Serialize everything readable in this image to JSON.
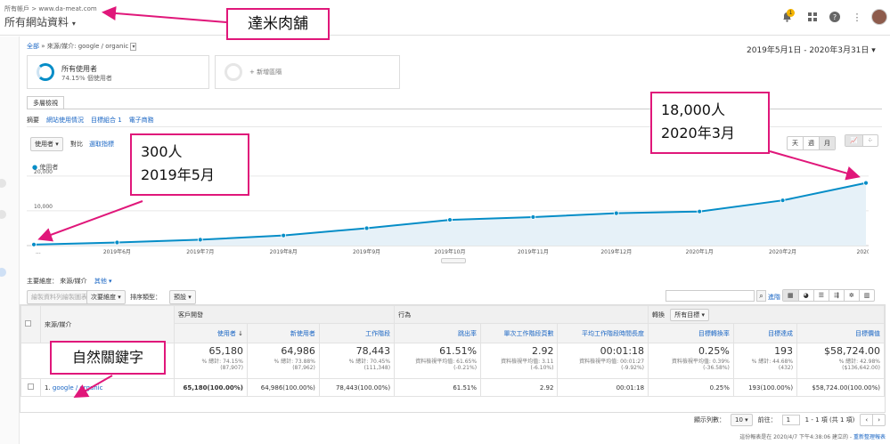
{
  "header": {
    "account_line": "所有帳戶 > www.da-meat.com",
    "property": "所有網站資料",
    "bell_badge": "1"
  },
  "breadcrumb": {
    "all": "全部",
    "sep": "»",
    "path": "來源/媒介: google / organic"
  },
  "date_range": "2019年5月1日 - 2020年3月31日",
  "segments": {
    "seg1_title": "所有使用者",
    "seg1_sub": "74.15% 個使用者",
    "add_label": "+ 新增區隔"
  },
  "tabs": {
    "main_tab": "多層檢視",
    "subtabs": [
      "摘要",
      "網站使用情況",
      "目標組合 1",
      "電子商務"
    ]
  },
  "chart_controls": {
    "metric_select": "使用者",
    "vs_label": "對比",
    "pick_metric": "選取指標",
    "legend": "使用者",
    "periods": [
      "天",
      "週",
      "月"
    ]
  },
  "chart_data": {
    "type": "area",
    "x": [
      "2019-05",
      "2019-06",
      "2019-07",
      "2019-08",
      "2019-09",
      "2019-10",
      "2019-11",
      "2019-12",
      "2020-01",
      "2020-02",
      "2020-03"
    ],
    "x_tick_labels": [
      "...",
      "2019年6月",
      "2019年7月",
      "2019年8月",
      "2019年9月",
      "2019年10月",
      "2019年11月",
      "2019年12月",
      "2020年1月",
      "2020年2月",
      "2020..."
    ],
    "series": [
      {
        "name": "使用者",
        "values": [
          300,
          900,
          1700,
          2900,
          5000,
          7400,
          8200,
          9300,
          9800,
          13000,
          18000
        ]
      }
    ],
    "y_ticks": [
      "20,000",
      "10,000"
    ],
    "ylim": [
      0,
      22000
    ],
    "color": "#058dc7",
    "grid": true
  },
  "toolbar": {
    "primary_dim_label": "主要維度：",
    "primary_dim": "來源/媒介",
    "other": "其他",
    "plot_rows": "繪製資料列繪製圖表",
    "secondary_dim": "次要維度",
    "sort_label": "排序類型：",
    "sort_value": "預設",
    "advanced": "進階"
  },
  "table": {
    "dim_header": "來源/媒介",
    "group_acq": "客戶開發",
    "group_beh": "行為",
    "group_conv": "轉換",
    "goal_select": "所有目標",
    "columns": [
      "使用者",
      "新使用者",
      "工作階段",
      "跳出率",
      "單次工作階段頁數",
      "平均工作階段時間長度",
      "目標轉換率",
      "目標達成",
      "目標價值"
    ],
    "totals": [
      {
        "big": "65,180",
        "sm": "% 總計: 74.15% (87,907)"
      },
      {
        "big": "64,986",
        "sm": "% 總計: 73.88% (87,962)"
      },
      {
        "big": "78,443",
        "sm": "% 總計: 70.45% (111,348)"
      },
      {
        "big": "61.51%",
        "sm": "資料檢視平均值: 61.65% (-0.21%)"
      },
      {
        "big": "2.92",
        "sm": "資料檢視平均值: 3.11 (-6.10%)"
      },
      {
        "big": "00:01:18",
        "sm": "資料檢視平均值: 00:01:27 (-9.92%)"
      },
      {
        "big": "0.25%",
        "sm": "資料檢視平均值: 0.39% (-36.58%)"
      },
      {
        "big": "193",
        "sm": "% 總計: 44.68% (432)"
      },
      {
        "big": "$58,724.00",
        "sm": "% 總計: 42.98% ($136,642.00)"
      }
    ],
    "row": {
      "idx": "1.",
      "name": "google / organic",
      "values": [
        "65,180(100.00%)",
        "64,986(100.00%)",
        "78,443(100.00%)",
        "61.51%",
        "2.92",
        "00:01:18",
        "0.25%",
        "193(100.00%)",
        "$58,724.00(100.00%)"
      ]
    }
  },
  "pager": {
    "rows_label": "顯示列數：",
    "rows_value": "10",
    "goto_label": "前往：",
    "goto_value": "1",
    "range": "1 - 1 項 (共 1 項)"
  },
  "footer": {
    "generated": "這份報表是在 2020/4/7 下午4:38:06 建立的 -",
    "refresh": "重新整理報表"
  },
  "annotations": {
    "title": "達米肉舖",
    "start_a": "300人",
    "start_b": "2019年5月",
    "end_a": "18,000人",
    "end_b": "2020年3月",
    "keyword": "自然關鍵字"
  }
}
